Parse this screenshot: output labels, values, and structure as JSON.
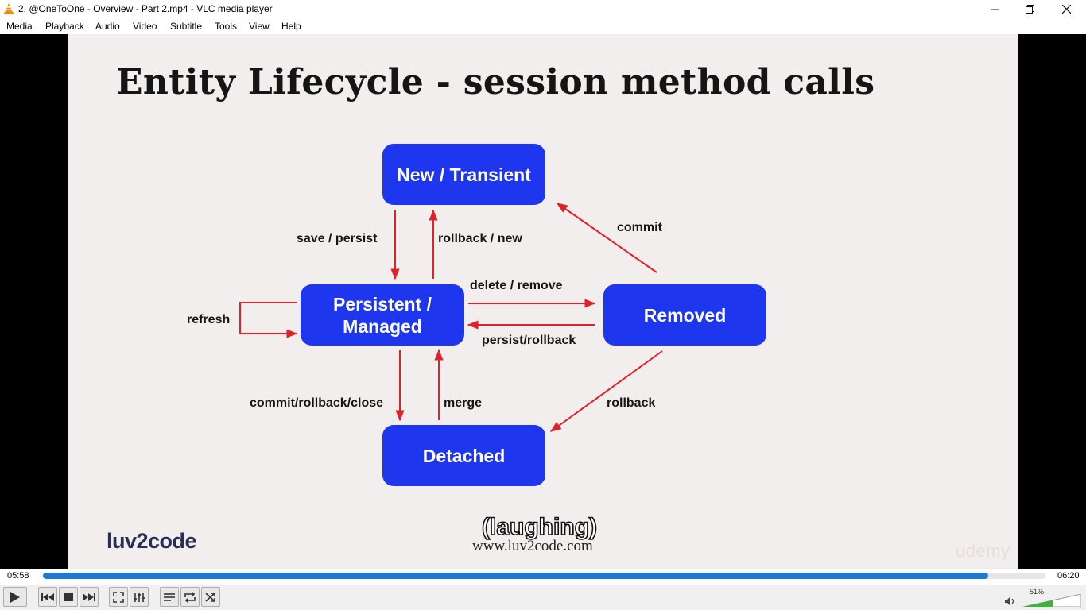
{
  "window": {
    "title": "2. @OneToOne - Overview - Part 2.mp4 - VLC media player",
    "icon": "vlc-cone-icon"
  },
  "menu": [
    "Media",
    "Playback",
    "Audio",
    "Video",
    "Subtitle",
    "Tools",
    "View",
    "Help"
  ],
  "slide": {
    "title": "Entity Lifecycle - session method calls",
    "states": {
      "new": "New / Transient",
      "persistent": "Persistent / Managed",
      "removed": "Removed",
      "detached": "Detached"
    },
    "transitions": {
      "save_persist": "save / persist",
      "rollback_new": "rollback / new",
      "commit": "commit",
      "refresh": "refresh",
      "delete_remove": "delete / remove",
      "persist_rollback": "persist/rollback",
      "commit_rollback_close": "commit/rollback/close",
      "merge": "merge",
      "rollback": "rollback"
    },
    "logo": "luv2code",
    "url": "www.luv2code.com",
    "watermark": "udemy",
    "box_color": "#1f36ef",
    "arrow_color": "#e0202b"
  },
  "subtitle": "(laughing)",
  "player": {
    "elapsed": "05:58",
    "total": "06:20",
    "progress_fraction": 0.943,
    "volume_label": "51%",
    "volume_fraction": 0.51,
    "accent_color": "#1e7ad6"
  }
}
